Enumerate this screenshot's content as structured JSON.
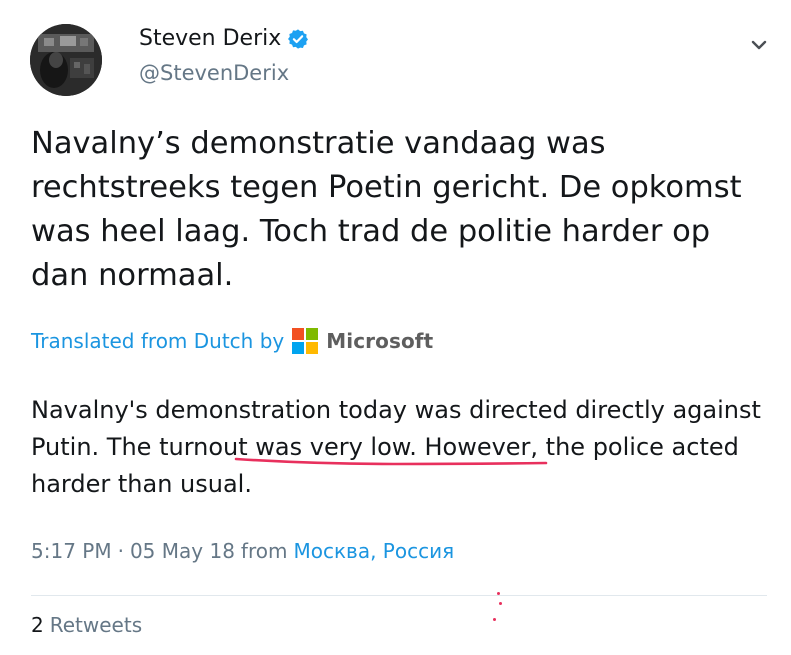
{
  "author": {
    "name": "Steven Derix",
    "handle": "@StevenDerix",
    "verified": true
  },
  "tweet": {
    "text": "Navalny’s demonstratie vandaag was rechtstreeks tegen Poetin gericht. De opkomst was heel laag. Toch trad de politie harder op dan normaal."
  },
  "translation": {
    "credit_label": "Translated from Dutch by",
    "provider": "Microsoft",
    "text_before": "Navalny's demonstration today was directed directly against Putin. T",
    "text_highlight": "he turnout was very low",
    "text_after": ". However, the police acted harder than usual."
  },
  "meta": {
    "time": "5:17 PM",
    "separator": "·",
    "date": "05 May 18",
    "from_label": "from",
    "location": "Москва, Россия"
  },
  "stats": {
    "retweet_count": "2",
    "retweet_label": "Retweets"
  },
  "colors": {
    "link_blue": "#1b95e0",
    "verified_blue": "#1da1f2",
    "underline_red": "#e8305d",
    "ms_red": "#f25022",
    "ms_green": "#7fba00",
    "ms_blue": "#00a4ef",
    "ms_yellow": "#ffb900"
  },
  "icons": {
    "verified": "verified-badge-icon",
    "caret": "chevron-down-icon",
    "microsoft": "microsoft-logo-icon"
  }
}
